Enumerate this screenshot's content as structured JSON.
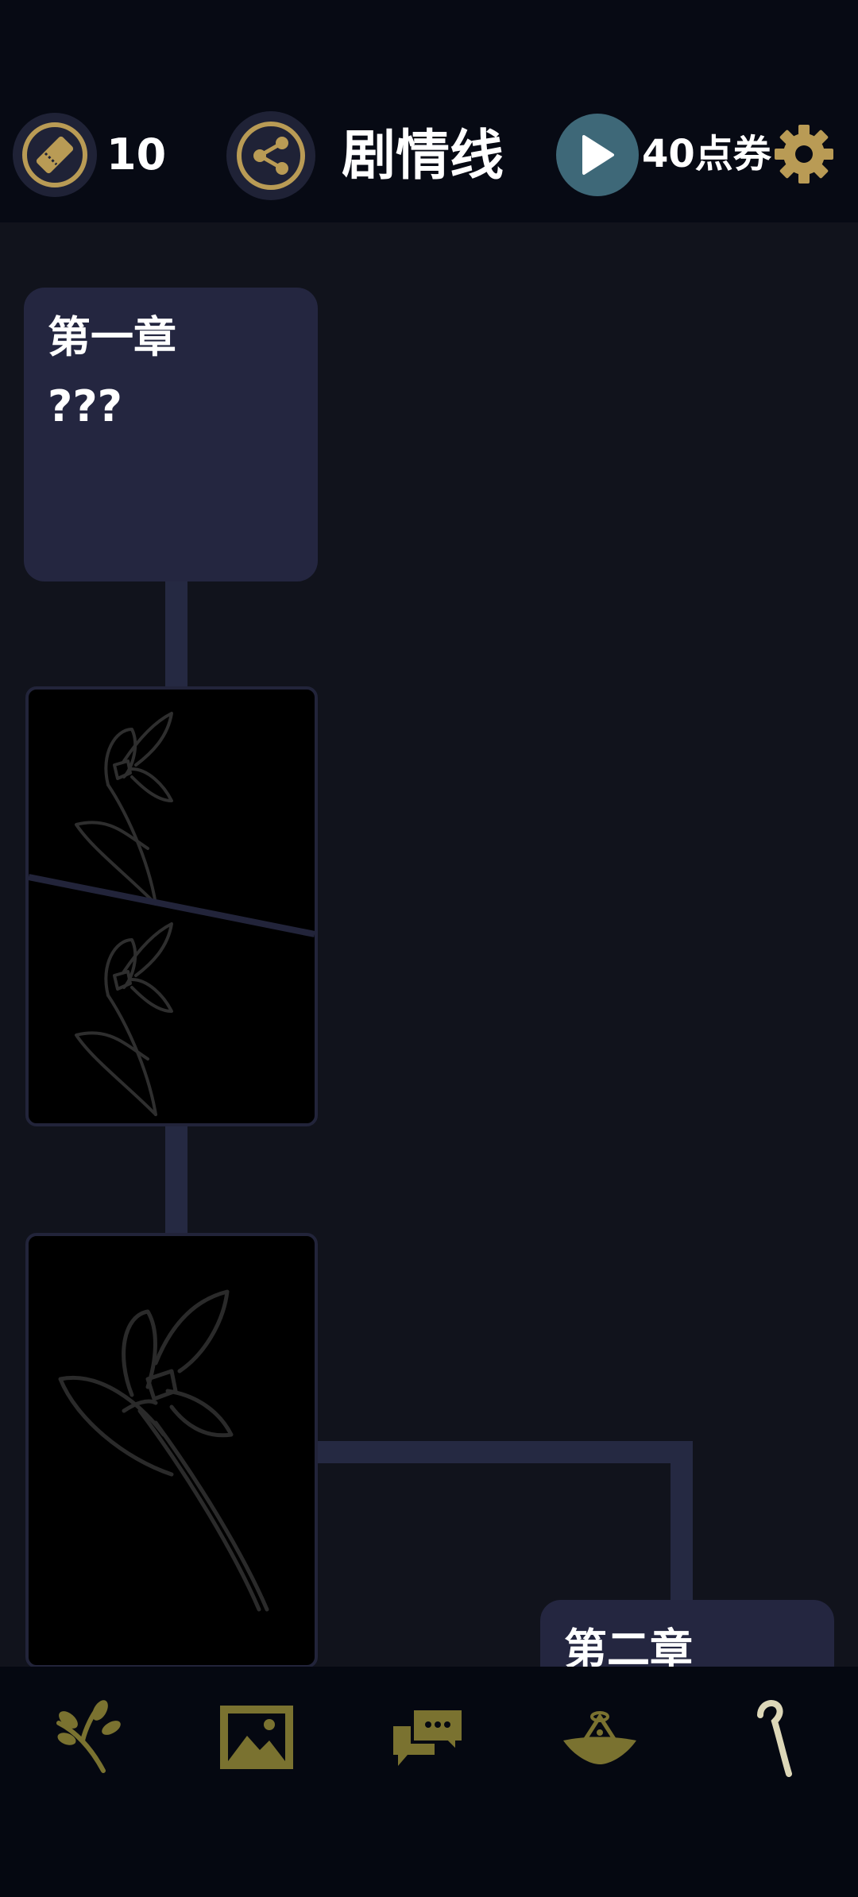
{
  "header": {
    "ticket_count": "10",
    "title": "剧情线",
    "points": "40点券"
  },
  "chapters": [
    {
      "title": "第一章",
      "subtitle": "???"
    },
    {
      "title": "第二章"
    }
  ],
  "icons": {
    "ticket": "ticket-icon",
    "share": "share-icon",
    "play": "play-icon",
    "settings": "gear-icon",
    "nav": [
      "branch-icon",
      "gallery-icon",
      "chat-icon",
      "hat-icon",
      "cane-icon"
    ]
  },
  "colors": {
    "accent_gold": "#b99b55",
    "nav_gold": "#7a7230",
    "play_teal": "#3e6878",
    "card_bg": "#242640",
    "background": "#11131c"
  }
}
